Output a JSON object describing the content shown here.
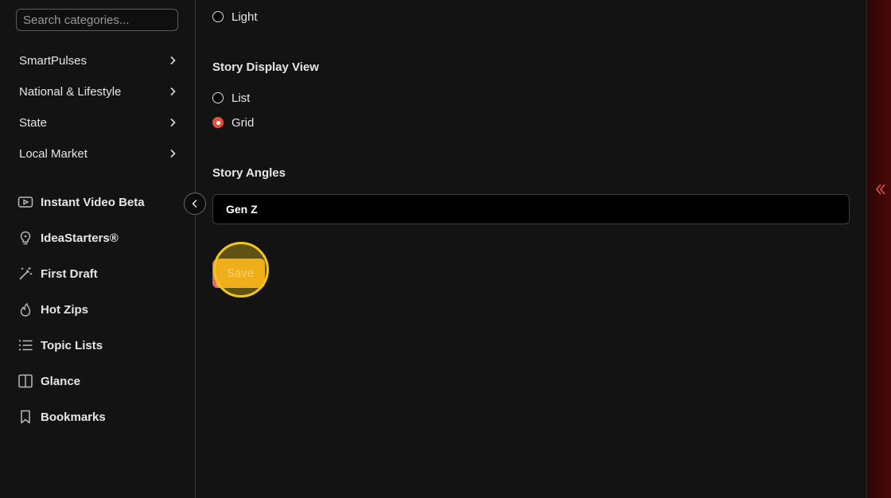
{
  "sidebar": {
    "search": {
      "placeholder": "Search categories...",
      "value": ""
    },
    "categories": [
      {
        "label": "SmartPulses"
      },
      {
        "label": "National & Lifestyle"
      },
      {
        "label": "State"
      },
      {
        "label": "Local Market"
      }
    ],
    "tools": [
      {
        "label": "Instant Video Beta",
        "icon": "video-icon"
      },
      {
        "label": "IdeaStarters®",
        "icon": "lightbulb-icon"
      },
      {
        "label": "First Draft",
        "icon": "magic-wand-icon"
      },
      {
        "label": "Hot Zips",
        "icon": "flame-icon"
      },
      {
        "label": "Topic Lists",
        "icon": "list-icon"
      },
      {
        "label": "Glance",
        "icon": "columns-icon"
      },
      {
        "label": "Bookmarks",
        "icon": "bookmark-icon"
      }
    ]
  },
  "settings": {
    "theme_option_light": "Light",
    "display_view": {
      "title": "Story Display View",
      "options": [
        "List",
        "Grid"
      ],
      "selected": "Grid"
    },
    "angles": {
      "title": "Story Angles",
      "value": "Gen Z"
    },
    "save_label": "Save"
  },
  "colors": {
    "accent_radio": "#e8513a",
    "save_button": "#f0a020",
    "highlight_ring": "#f2c71b",
    "side_strip": "#3a0606"
  }
}
